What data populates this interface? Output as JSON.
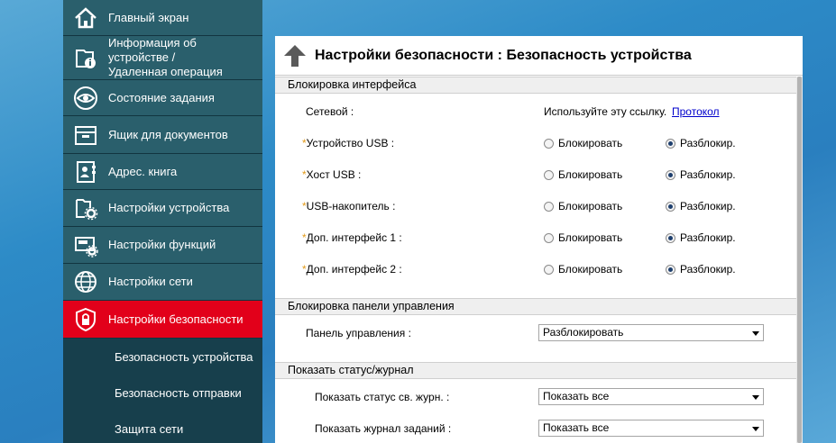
{
  "sidebar": {
    "items": [
      {
        "label": "Главный экран",
        "icon": "home-icon"
      },
      {
        "label": "Информация об устройстве / Удаленная операция",
        "icon": "device-info-icon"
      },
      {
        "label": "Состояние задания",
        "icon": "eye-icon"
      },
      {
        "label": "Ящик для документов",
        "icon": "document-box-icon"
      },
      {
        "label": "Адрес. книга",
        "icon": "address-book-icon"
      },
      {
        "label": "Настройки устройства",
        "icon": "device-settings-icon"
      },
      {
        "label": "Настройки функций",
        "icon": "function-settings-icon"
      },
      {
        "label": "Настройки сети",
        "icon": "globe-icon"
      },
      {
        "label": "Настройки безопасности",
        "icon": "shield-icon"
      }
    ],
    "sub_items": [
      {
        "label": "Безопасность устройства"
      },
      {
        "label": "Безопасность отправки"
      },
      {
        "label": "Защита сети"
      }
    ],
    "active_color": "#e2001a"
  },
  "page": {
    "title": "Настройки безопасности : Безопасность устройства"
  },
  "sections": {
    "interface_lock": {
      "header": "Блокировка интерфейса",
      "network_label": "Сетевой :",
      "network_text": "Используйте эту ссылку.",
      "network_link": "Протокол",
      "rows": [
        {
          "label": "Устройство USB :",
          "lock": "Блокировать",
          "unlock": "Разблокир."
        },
        {
          "label": "Хост USB :",
          "lock": "Блокировать",
          "unlock": "Разблокир."
        },
        {
          "label": "USB-накопитель :",
          "lock": "Блокировать",
          "unlock": "Разблокир."
        },
        {
          "label": "Доп. интерфейс 1 :",
          "lock": "Блокировать",
          "unlock": "Разблокир."
        },
        {
          "label": "Доп. интерфейс 2 :",
          "lock": "Блокировать",
          "unlock": "Разблокир."
        }
      ],
      "required_mark": "*"
    },
    "panel_lock": {
      "header": "Блокировка панели управления",
      "label": "Панель управления :",
      "value": "Разблокировать"
    },
    "status_log": {
      "header": "Показать статус/журнал",
      "status_label": "Показать статус св. журн. :",
      "status_value": "Показать все",
      "jobs_label": "Показать журнал заданий :",
      "jobs_value": "Показать все"
    }
  }
}
